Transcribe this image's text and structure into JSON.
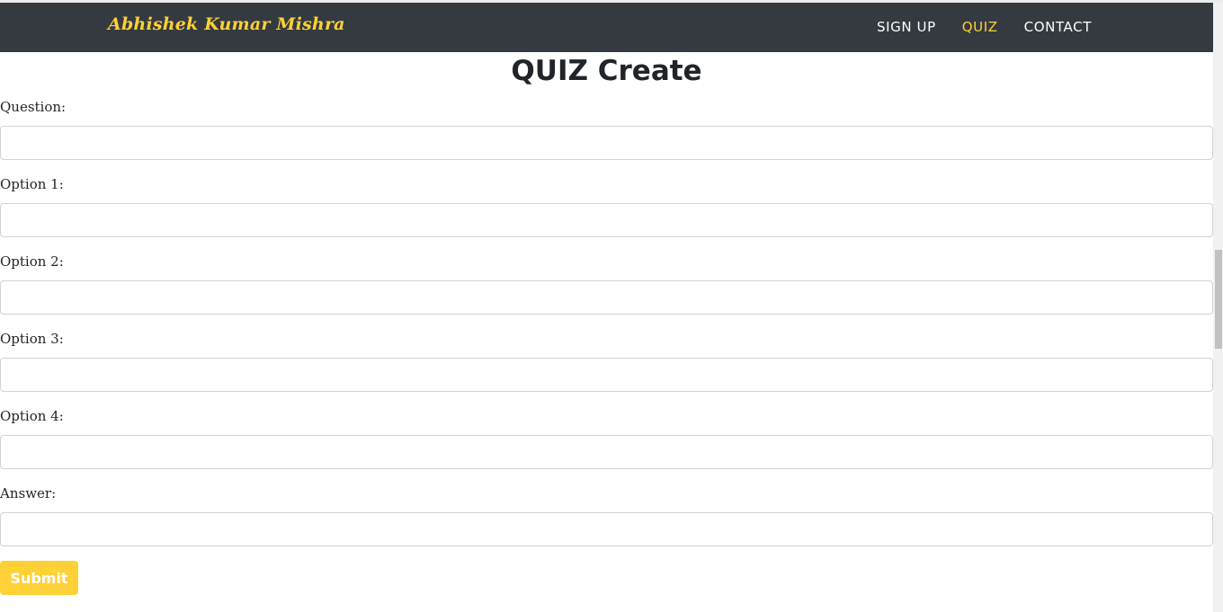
{
  "navbar": {
    "brand": "Abhishek Kumar Mishra",
    "links": [
      {
        "label": "SIGN UP",
        "active": false
      },
      {
        "label": "QUIZ",
        "active": true
      },
      {
        "label": "CONTACT",
        "active": false
      }
    ]
  },
  "page": {
    "title": "QUIZ Create"
  },
  "form": {
    "fields": [
      {
        "label": "Question:",
        "value": "",
        "placeholder": ""
      },
      {
        "label": "Option 1:",
        "value": "",
        "placeholder": ""
      },
      {
        "label": "Option 2:",
        "value": "",
        "placeholder": ""
      },
      {
        "label": "Option 3:",
        "value": "",
        "placeholder": ""
      },
      {
        "label": "Option 4:",
        "value": "",
        "placeholder": ""
      },
      {
        "label": "Answer:",
        "value": "",
        "placeholder": ""
      }
    ],
    "submit_label": "Submit"
  },
  "colors": {
    "navbar_bg": "#343a40",
    "accent": "#fed136",
    "text": "#212529",
    "input_border": "#ced4da"
  }
}
